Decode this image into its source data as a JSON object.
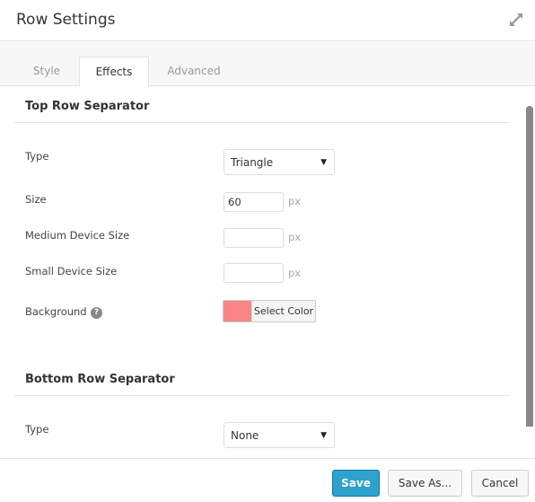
{
  "header": {
    "title": "Row Settings",
    "expand_icon": "expand-arrows-icon"
  },
  "tabs": [
    {
      "label": "Style",
      "active": false
    },
    {
      "label": "Effects",
      "active": true
    },
    {
      "label": "Advanced",
      "active": false
    }
  ],
  "top_separator": {
    "title": "Top Row Separator",
    "type_label": "Type",
    "type_value": "Triangle",
    "size_label": "Size",
    "size_value": "60",
    "size_unit": "px",
    "medium_label": "Medium Device Size",
    "medium_value": "",
    "medium_unit": "px",
    "small_label": "Small Device Size",
    "small_value": "",
    "small_unit": "px",
    "background_label": "Background",
    "help_icon": "?",
    "background_color": "#f98584",
    "select_color_label": "Select Color"
  },
  "bottom_separator": {
    "title": "Bottom Row Separator",
    "type_label": "Type",
    "type_value": "None"
  },
  "select_arrow": "▼",
  "footer": {
    "save_label": "Save",
    "save_as_label": "Save As...",
    "cancel_label": "Cancel"
  },
  "colors": {
    "primary": "#2ea2cc",
    "swatch": "#f98584"
  }
}
